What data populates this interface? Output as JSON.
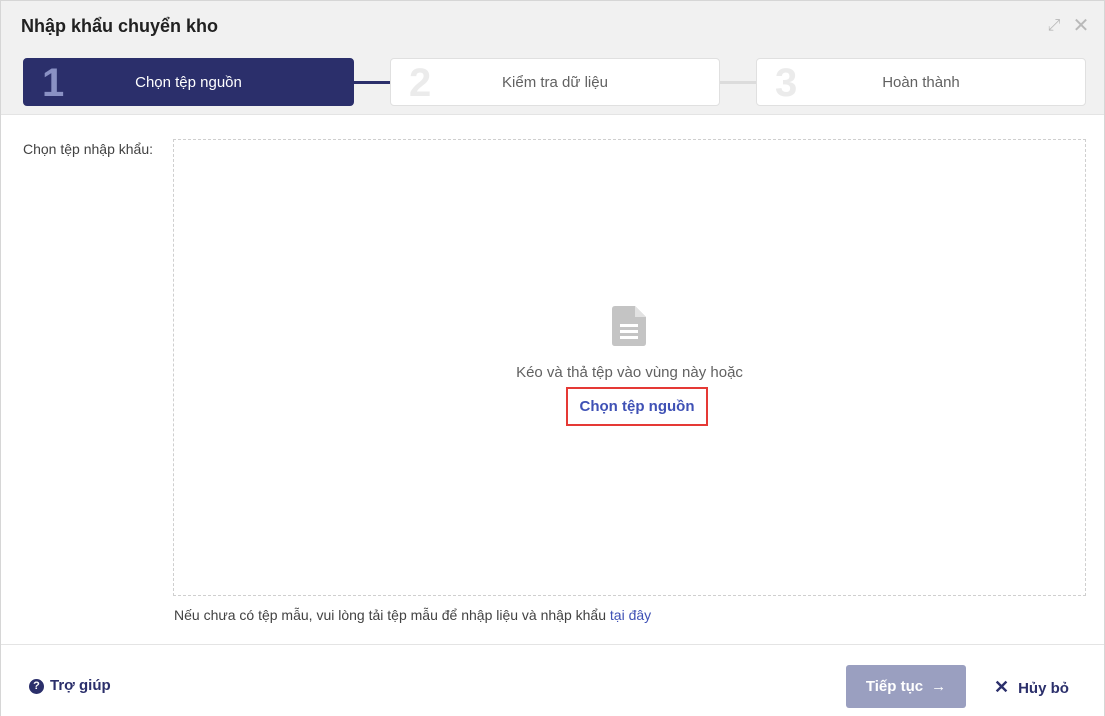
{
  "dialog": {
    "title": "Nhập khẩu chuyển kho",
    "expand_icon": "expand-icon",
    "close_icon": "close-icon"
  },
  "steps": [
    {
      "number": "1",
      "label": "Chọn tệp nguồn",
      "active": true
    },
    {
      "number": "2",
      "label": "Kiểm tra dữ liệu",
      "active": false
    },
    {
      "number": "3",
      "label": "Hoàn thành",
      "active": false
    }
  ],
  "upload": {
    "field_label": "Chọn tệp nhập khẩu:",
    "drop_text": "Kéo và thả tệp vào vùng này hoặc",
    "choose_link": "Chọn tệp nguồn",
    "file_icon": "file-icon"
  },
  "hint": {
    "text": "Nếu chưa có tệp mẫu, vui lòng tải tệp mẫu để nhập liệu và nhập khẩu",
    "link": "tại đây"
  },
  "footer": {
    "help_label": "Trợ giúp",
    "next_label": "Tiếp tục",
    "cancel_label": "Hủy bỏ"
  },
  "colors": {
    "primary": "#2b2f6b",
    "link": "#3f51b5",
    "highlight_border": "#e53935",
    "disabled_button": "#9a9fc0"
  }
}
